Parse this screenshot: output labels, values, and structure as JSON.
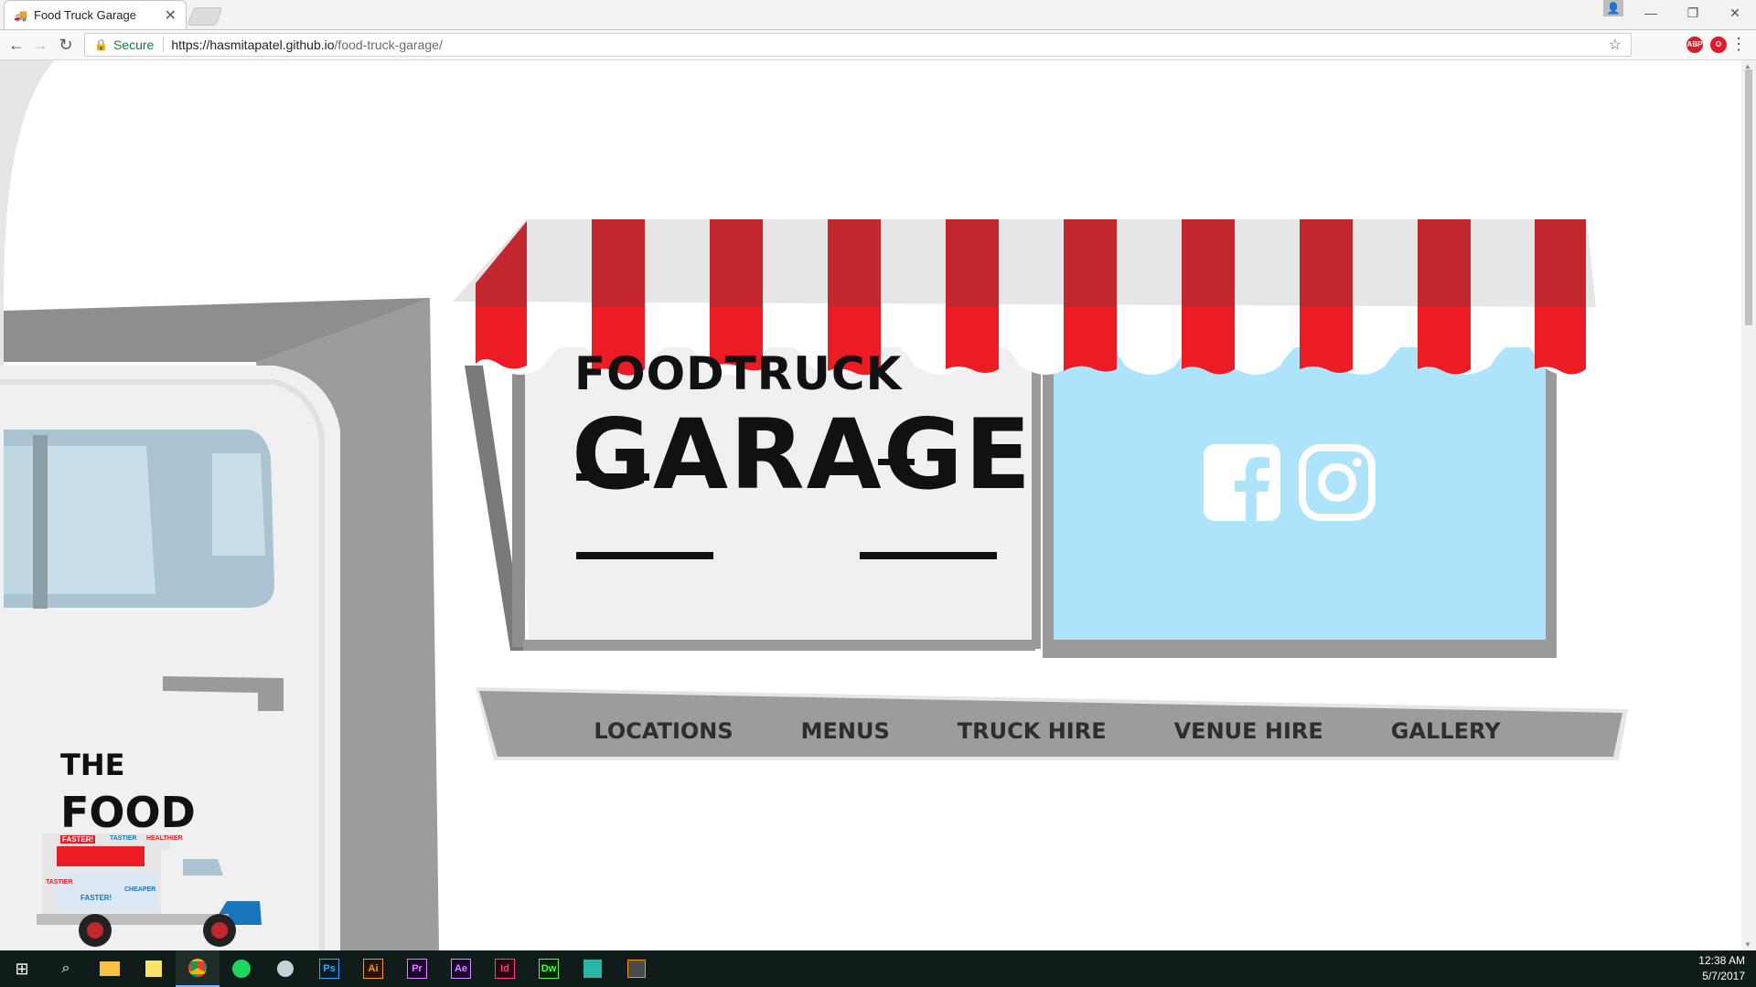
{
  "browser": {
    "tab_title": "Food Truck Garage",
    "tab_close": "✕",
    "secure_label": "Secure",
    "url_scheme_host": "https://hasmitapatel.github.io",
    "url_path": "/food-truck-garage/"
  },
  "site": {
    "logo_line1": "FOODTRUCK",
    "logo_line2": "GARAGE",
    "nav": [
      "LOCATIONS",
      "MENUS",
      "TRUCK HIRE",
      "VENUE HIRE",
      "GALLERY"
    ],
    "mini_logo_line1": "THE",
    "mini_logo_line2": "FOOD",
    "truck_decals": [
      "FASTER!",
      "TASTIER",
      "HEALTHIER",
      "CHEAPER",
      "FASTER!",
      "TASTIER"
    ]
  },
  "taskbar": {
    "apps": [
      "Ps",
      "Ai",
      "Pr",
      "Ae",
      "Id",
      "Dw"
    ],
    "time": "12:38 AM",
    "date": "5/7/2017"
  },
  "colors": {
    "awning_red": "#ec1c24",
    "awning_red_dark": "#c1272d",
    "sky_blue": "#ade3fb",
    "gray_frame": "#9a9a9a"
  }
}
